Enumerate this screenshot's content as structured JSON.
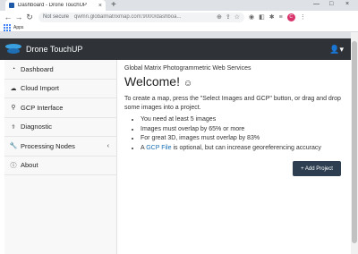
{
  "browser": {
    "tab_title": "Dashboard - Drone TouchUP",
    "tab_close": "×",
    "new_tab": "+",
    "window_buttons": {
      "minimize": "—",
      "maximize": "□",
      "close": "×"
    },
    "nav": {
      "back": "←",
      "forward": "→",
      "reload": "↻"
    },
    "security_label": "Not secure",
    "url": "qwmn.globalmatrixmap.com:9000/dashboa...",
    "profile_initial": "C",
    "bookmarks": {
      "apps_label": "Apps"
    }
  },
  "navbar": {
    "brand": "Drone TouchUP",
    "user_menu": "👤▾"
  },
  "sidebar": {
    "items": [
      {
        "label": "Dashboard",
        "icon": "dashboard-icon",
        "glyph": "◔"
      },
      {
        "label": "Cloud Import",
        "icon": "cloud-icon",
        "glyph": "☁"
      },
      {
        "label": "GCP Interface",
        "icon": "map-marker-icon",
        "glyph": "⚲"
      },
      {
        "label": "Diagnostic",
        "icon": "diagnostic-icon",
        "glyph": "⚕"
      },
      {
        "label": "Processing Nodes",
        "icon": "wrench-icon",
        "glyph": "🔧",
        "arrow": "‹"
      },
      {
        "label": "About",
        "icon": "info-icon",
        "glyph": "ⓘ"
      }
    ]
  },
  "main": {
    "subtitle": "Global Matrix Photogrammetric Web Services",
    "welcome": "Welcome!",
    "welcome_emoji": "☺",
    "intro": "To create a map, press the \"Select Images and GCP\" button, or drag and drop some images into a project.",
    "requirements": [
      "You need at least 5 images",
      "Images must overlap by 65% or more",
      "For great 3D, images must overlap by 83%"
    ],
    "gcp_prefix": "A ",
    "gcp_link": "GCP File",
    "gcp_suffix": " is optional, but can increase georeferencing accuracy",
    "add_project": "+ Add Project"
  }
}
